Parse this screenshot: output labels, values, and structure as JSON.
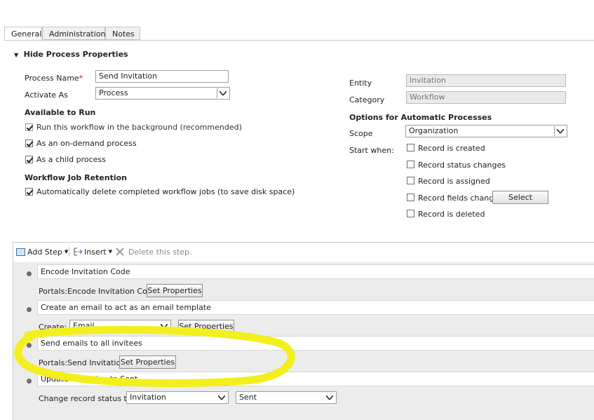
{
  "tabs": [
    "General",
    "Administration",
    "Notes"
  ],
  "properties_header": "Hide Process Properties",
  "process_name": {
    "label": "Process Name",
    "required_mark": "*",
    "value": "Send Invitation"
  },
  "activate_as": {
    "label": "Activate As",
    "value": "Process"
  },
  "available_to_run": {
    "title": "Available to Run",
    "options": [
      {
        "label": "Run this workflow in the background (recommended)",
        "checked": true,
        "disabled": true
      },
      {
        "label": "As an on-demand process",
        "checked": true
      },
      {
        "label": "As a child process",
        "checked": true
      }
    ]
  },
  "retention": {
    "title": "Workflow Job Retention",
    "option": {
      "label": "Automatically delete completed workflow jobs (to save disk space)",
      "checked": true
    }
  },
  "entity": {
    "label": "Entity",
    "value": "Invitation"
  },
  "category": {
    "label": "Category",
    "value": "Workflow"
  },
  "auto_options": {
    "title": "Options for Automatic Processes",
    "scope_label": "Scope",
    "scope_value": "Organization",
    "start_when_label": "Start when:",
    "triggers": [
      "Record is created",
      "Record status changes",
      "Record is assigned",
      "Record fields change",
      "Record is deleted"
    ],
    "select_button": "Select"
  },
  "toolbar": {
    "add_step": "Add Step",
    "insert": "Insert",
    "delete": "Delete this step."
  },
  "steps": [
    {
      "title": "Encode Invitation Code",
      "detail_label": "Portals:Encode Invitation Code",
      "button": "Set Properties"
    },
    {
      "title": "Create an email to act as an email template",
      "detail_label": "Create:",
      "select_value": "Email",
      "button": "Set Properties"
    },
    {
      "title": "Send emails to all invitees",
      "detail_label": "Portals:Send Invitation",
      "button": "Set Properties"
    },
    {
      "title": "Update Invitation to Sent",
      "detail_label": "Change record status to:",
      "select_value": "Invitation",
      "select_value2": "Sent"
    }
  ],
  "highlight_color": "#f3ef1c"
}
